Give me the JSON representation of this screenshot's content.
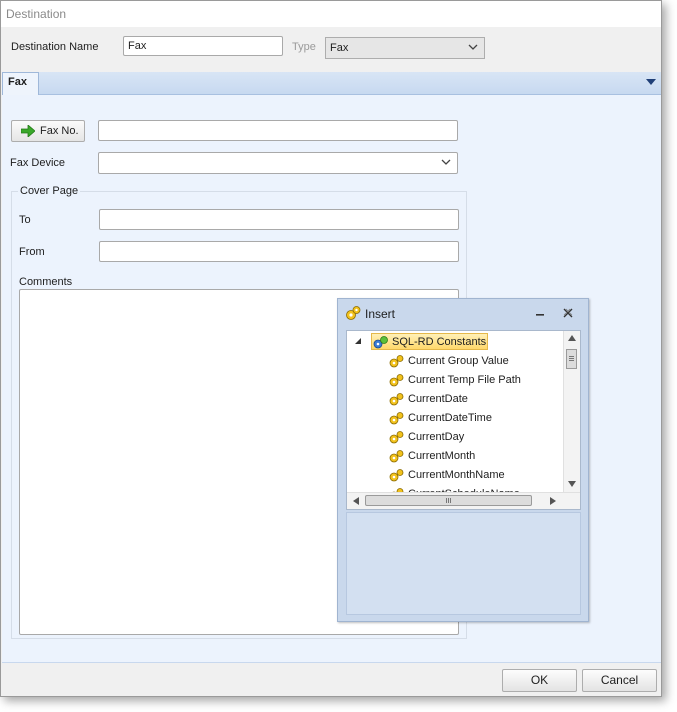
{
  "window": {
    "title": "Destination"
  },
  "header": {
    "destination_name_label": "Destination Name",
    "destination_name_value": "Fax",
    "type_label": "Type",
    "type_value": "Fax"
  },
  "tabs": [
    {
      "label": "Fax"
    }
  ],
  "fax": {
    "fax_no_button": "Fax No.",
    "fax_no_value": "",
    "fax_device_label": "Fax Device",
    "fax_device_value": "",
    "cover_page": {
      "group_title": "Cover Page",
      "to_label": "To",
      "to_value": "",
      "from_label": "From",
      "from_value": "",
      "comments_label": "Comments",
      "comments_value": ""
    }
  },
  "insert_panel": {
    "title": "Insert",
    "root": "SQL-RD Constants",
    "items": [
      "Current Group Value",
      "Current Temp File Path",
      "CurrentDate",
      "CurrentDateTime",
      "CurrentDay",
      "CurrentMonth",
      "CurrentMonthName",
      "CurrentScheduleName"
    ]
  },
  "footer": {
    "ok_label": "OK",
    "cancel_label": "Cancel"
  },
  "colors": {
    "tab_band": "#c7d9f0",
    "panel_bg": "#ecf3fd",
    "selection": "#ffd86b",
    "arrow_green": "#3aa82a"
  }
}
